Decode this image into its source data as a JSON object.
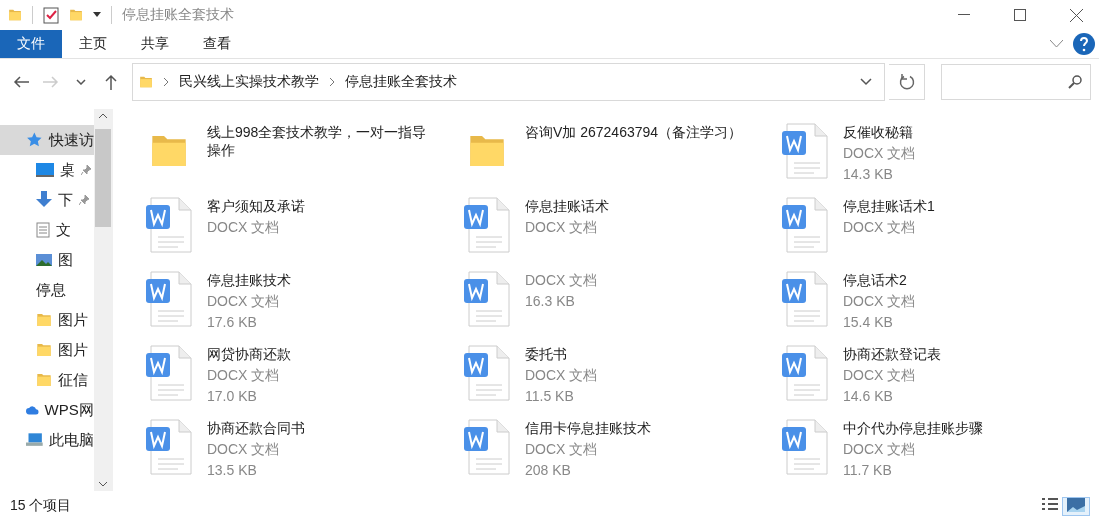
{
  "window": {
    "title": "停息挂账全套技术"
  },
  "ribbon_tabs": [
    {
      "label": "文件",
      "selected": true
    },
    {
      "label": "主页",
      "selected": false
    },
    {
      "label": "共享",
      "selected": false
    },
    {
      "label": "查看",
      "selected": false
    }
  ],
  "address": {
    "crumbs": [
      "民兴线上实操技术教学",
      "停息挂账全套技术"
    ]
  },
  "sidebar": {
    "items": [
      {
        "label": "快速访",
        "kind": "star",
        "selected": true,
        "children": [
          {
            "label": "桌",
            "kind": "desktop",
            "pinned": true
          },
          {
            "label": "下",
            "kind": "download",
            "pinned": true
          },
          {
            "label": "文",
            "kind": "docs",
            "pinned": false
          },
          {
            "label": "图",
            "kind": "pictures",
            "pinned": false
          },
          {
            "label": "停息",
            "kind": "none",
            "pinned": false
          },
          {
            "label": "图片",
            "kind": "folder",
            "pinned": false
          },
          {
            "label": "图片",
            "kind": "folder",
            "pinned": false
          },
          {
            "label": "征信",
            "kind": "folder",
            "pinned": false
          }
        ]
      },
      {
        "label": "WPS网",
        "kind": "cloud",
        "selected": false
      },
      {
        "label": "此电脑",
        "kind": "pc",
        "selected": false
      }
    ]
  },
  "files": [
    {
      "kind": "folder",
      "name": "线上998全套技术教学，一对一指导操作"
    },
    {
      "kind": "folder",
      "name": "咨询V加  2672463794（备注学习）"
    },
    {
      "kind": "docx",
      "name": "反催收秘籍",
      "type": "DOCX 文档",
      "size": "14.3 KB"
    },
    {
      "kind": "docx",
      "name": "客户须知及承诺",
      "type": "DOCX 文档"
    },
    {
      "kind": "docx",
      "name": "停息挂账话术",
      "type": "DOCX 文档"
    },
    {
      "kind": "docx",
      "name": "停息挂账话术1",
      "type": "DOCX 文档"
    },
    {
      "kind": "docx",
      "name": "停息挂账技术",
      "type": "DOCX 文档",
      "size": "17.6 KB"
    },
    {
      "kind": "docx",
      "type": "DOCX 文档",
      "size": "16.3 KB"
    },
    {
      "kind": "docx",
      "name": "停息话术2",
      "type": "DOCX 文档",
      "size": "15.4 KB"
    },
    {
      "kind": "docx",
      "name": "网贷协商还款",
      "type": "DOCX 文档",
      "size": "17.0 KB"
    },
    {
      "kind": "docx",
      "name": "委托书",
      "type": "DOCX 文档",
      "size": "11.5 KB"
    },
    {
      "kind": "docx",
      "name": "协商还款登记表",
      "type": "DOCX 文档",
      "size": "14.6 KB"
    },
    {
      "kind": "docx",
      "name": "协商还款合同书",
      "type": "DOCX 文档",
      "size": "13.5 KB"
    },
    {
      "kind": "docx",
      "name": "信用卡停息挂账技术",
      "type": "DOCX 文档",
      "size": "208 KB"
    },
    {
      "kind": "docx",
      "name": "中介代办停息挂账步骤",
      "type": "DOCX 文档",
      "size": "11.7 KB"
    }
  ],
  "status_bar": {
    "count": "15 个项目"
  },
  "view_buttons": [
    {
      "kind": "details",
      "selected": false
    },
    {
      "kind": "large_icons",
      "selected": true
    }
  ]
}
